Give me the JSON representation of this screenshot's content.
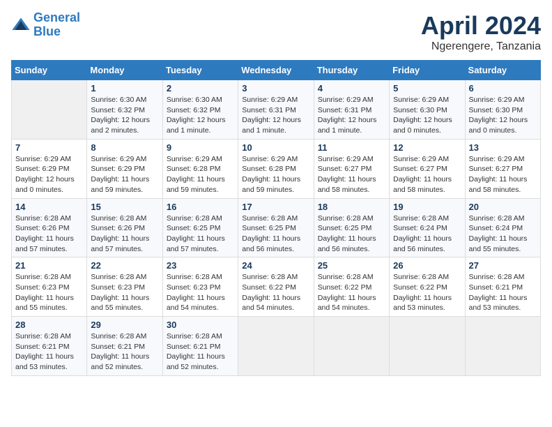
{
  "header": {
    "logo_line1": "General",
    "logo_line2": "Blue",
    "title": "April 2024",
    "subtitle": "Ngerengere, Tanzania"
  },
  "weekdays": [
    "Sunday",
    "Monday",
    "Tuesday",
    "Wednesday",
    "Thursday",
    "Friday",
    "Saturday"
  ],
  "weeks": [
    [
      {
        "day": "",
        "info": ""
      },
      {
        "day": "1",
        "info": "Sunrise: 6:30 AM\nSunset: 6:32 PM\nDaylight: 12 hours\nand 2 minutes."
      },
      {
        "day": "2",
        "info": "Sunrise: 6:30 AM\nSunset: 6:32 PM\nDaylight: 12 hours\nand 1 minute."
      },
      {
        "day": "3",
        "info": "Sunrise: 6:29 AM\nSunset: 6:31 PM\nDaylight: 12 hours\nand 1 minute."
      },
      {
        "day": "4",
        "info": "Sunrise: 6:29 AM\nSunset: 6:31 PM\nDaylight: 12 hours\nand 1 minute."
      },
      {
        "day": "5",
        "info": "Sunrise: 6:29 AM\nSunset: 6:30 PM\nDaylight: 12 hours\nand 0 minutes."
      },
      {
        "day": "6",
        "info": "Sunrise: 6:29 AM\nSunset: 6:30 PM\nDaylight: 12 hours\nand 0 minutes."
      }
    ],
    [
      {
        "day": "7",
        "info": "Sunrise: 6:29 AM\nSunset: 6:29 PM\nDaylight: 12 hours\nand 0 minutes."
      },
      {
        "day": "8",
        "info": "Sunrise: 6:29 AM\nSunset: 6:29 PM\nDaylight: 11 hours\nand 59 minutes."
      },
      {
        "day": "9",
        "info": "Sunrise: 6:29 AM\nSunset: 6:28 PM\nDaylight: 11 hours\nand 59 minutes."
      },
      {
        "day": "10",
        "info": "Sunrise: 6:29 AM\nSunset: 6:28 PM\nDaylight: 11 hours\nand 59 minutes."
      },
      {
        "day": "11",
        "info": "Sunrise: 6:29 AM\nSunset: 6:27 PM\nDaylight: 11 hours\nand 58 minutes."
      },
      {
        "day": "12",
        "info": "Sunrise: 6:29 AM\nSunset: 6:27 PM\nDaylight: 11 hours\nand 58 minutes."
      },
      {
        "day": "13",
        "info": "Sunrise: 6:29 AM\nSunset: 6:27 PM\nDaylight: 11 hours\nand 58 minutes."
      }
    ],
    [
      {
        "day": "14",
        "info": "Sunrise: 6:28 AM\nSunset: 6:26 PM\nDaylight: 11 hours\nand 57 minutes."
      },
      {
        "day": "15",
        "info": "Sunrise: 6:28 AM\nSunset: 6:26 PM\nDaylight: 11 hours\nand 57 minutes."
      },
      {
        "day": "16",
        "info": "Sunrise: 6:28 AM\nSunset: 6:25 PM\nDaylight: 11 hours\nand 57 minutes."
      },
      {
        "day": "17",
        "info": "Sunrise: 6:28 AM\nSunset: 6:25 PM\nDaylight: 11 hours\nand 56 minutes."
      },
      {
        "day": "18",
        "info": "Sunrise: 6:28 AM\nSunset: 6:25 PM\nDaylight: 11 hours\nand 56 minutes."
      },
      {
        "day": "19",
        "info": "Sunrise: 6:28 AM\nSunset: 6:24 PM\nDaylight: 11 hours\nand 56 minutes."
      },
      {
        "day": "20",
        "info": "Sunrise: 6:28 AM\nSunset: 6:24 PM\nDaylight: 11 hours\nand 55 minutes."
      }
    ],
    [
      {
        "day": "21",
        "info": "Sunrise: 6:28 AM\nSunset: 6:23 PM\nDaylight: 11 hours\nand 55 minutes."
      },
      {
        "day": "22",
        "info": "Sunrise: 6:28 AM\nSunset: 6:23 PM\nDaylight: 11 hours\nand 55 minutes."
      },
      {
        "day": "23",
        "info": "Sunrise: 6:28 AM\nSunset: 6:23 PM\nDaylight: 11 hours\nand 54 minutes."
      },
      {
        "day": "24",
        "info": "Sunrise: 6:28 AM\nSunset: 6:22 PM\nDaylight: 11 hours\nand 54 minutes."
      },
      {
        "day": "25",
        "info": "Sunrise: 6:28 AM\nSunset: 6:22 PM\nDaylight: 11 hours\nand 54 minutes."
      },
      {
        "day": "26",
        "info": "Sunrise: 6:28 AM\nSunset: 6:22 PM\nDaylight: 11 hours\nand 53 minutes."
      },
      {
        "day": "27",
        "info": "Sunrise: 6:28 AM\nSunset: 6:21 PM\nDaylight: 11 hours\nand 53 minutes."
      }
    ],
    [
      {
        "day": "28",
        "info": "Sunrise: 6:28 AM\nSunset: 6:21 PM\nDaylight: 11 hours\nand 53 minutes."
      },
      {
        "day": "29",
        "info": "Sunrise: 6:28 AM\nSunset: 6:21 PM\nDaylight: 11 hours\nand 52 minutes."
      },
      {
        "day": "30",
        "info": "Sunrise: 6:28 AM\nSunset: 6:21 PM\nDaylight: 11 hours\nand 52 minutes."
      },
      {
        "day": "",
        "info": ""
      },
      {
        "day": "",
        "info": ""
      },
      {
        "day": "",
        "info": ""
      },
      {
        "day": "",
        "info": ""
      }
    ]
  ]
}
